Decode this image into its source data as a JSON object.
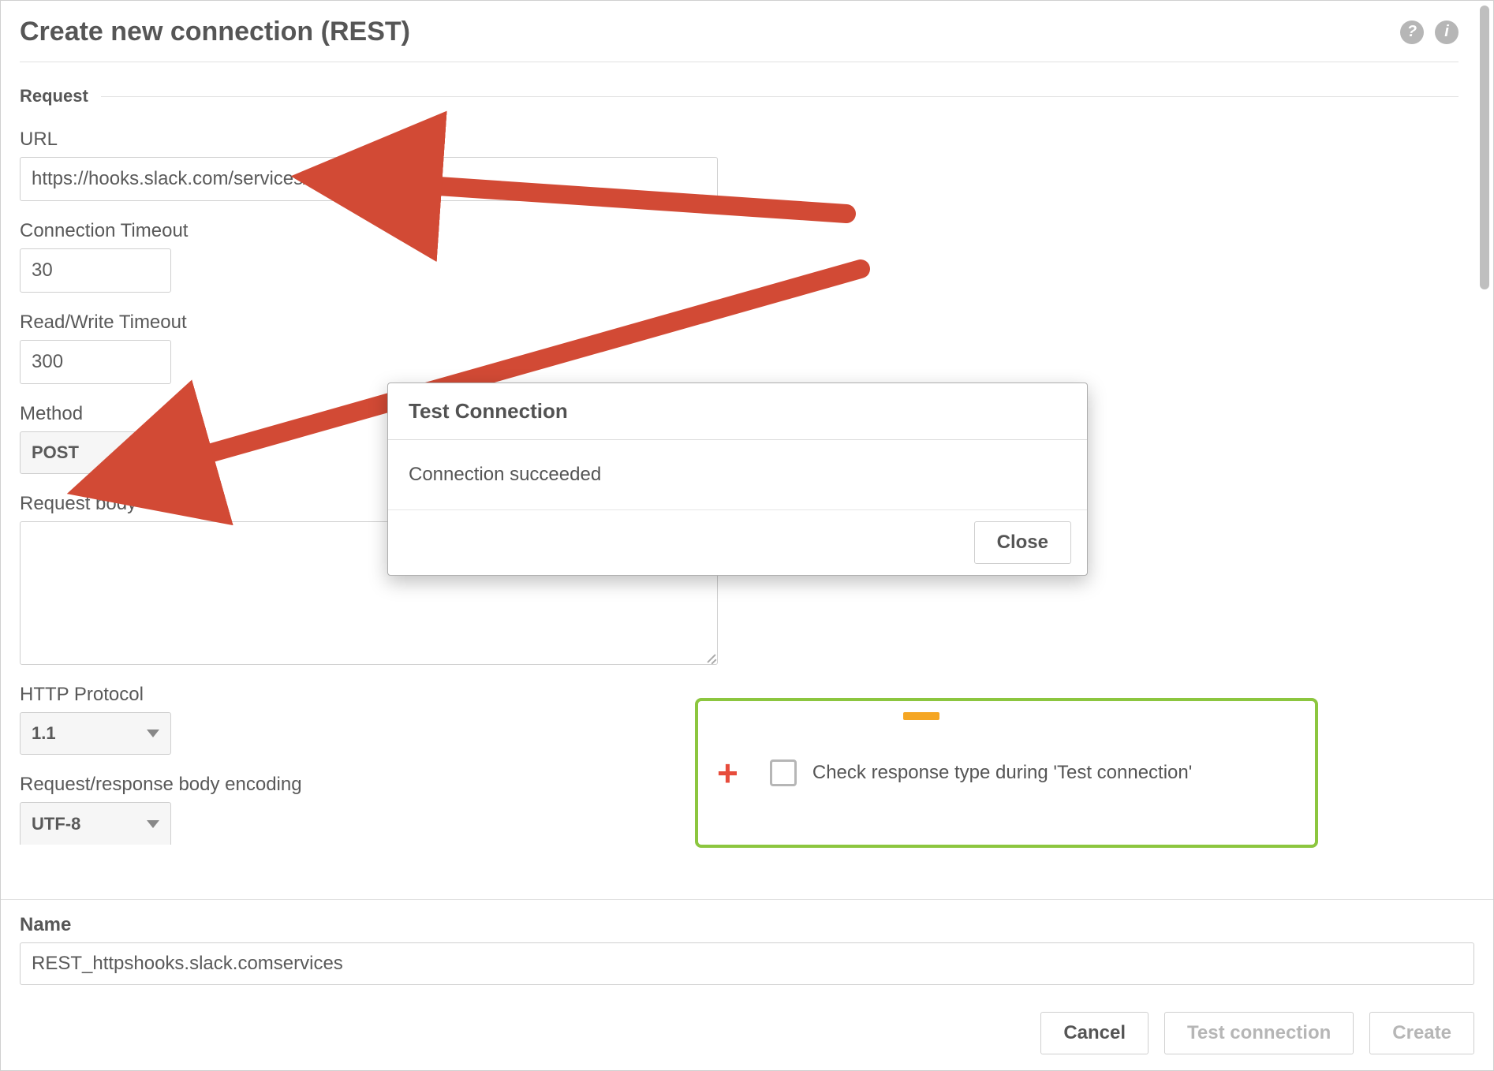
{
  "header": {
    "title": "Create new connection (REST)"
  },
  "section": {
    "request": "Request"
  },
  "labels": {
    "url": "URL",
    "conn_timeout": "Connection Timeout",
    "rw_timeout": "Read/Write Timeout",
    "method": "Method",
    "request_body": "Request body",
    "http_protocol": "HTTP Protocol",
    "body_encoding": "Request/response body encoding"
  },
  "values": {
    "url": "https://hooks.slack.com/services/",
    "conn_timeout": "30",
    "rw_timeout": "300",
    "method": "POST",
    "http_protocol": "1.1",
    "body_encoding": "UTF-8",
    "request_body": ""
  },
  "check_response": {
    "label": "Check response type during 'Test connection'"
  },
  "modal": {
    "title": "Test Connection",
    "message": "Connection succeeded",
    "close": "Close"
  },
  "name_section": {
    "label": "Name",
    "value": "REST_httpshooks.slack.comservices"
  },
  "footer": {
    "cancel": "Cancel",
    "test": "Test connection",
    "create": "Create"
  },
  "icons": {
    "help": "?",
    "info": "i"
  }
}
